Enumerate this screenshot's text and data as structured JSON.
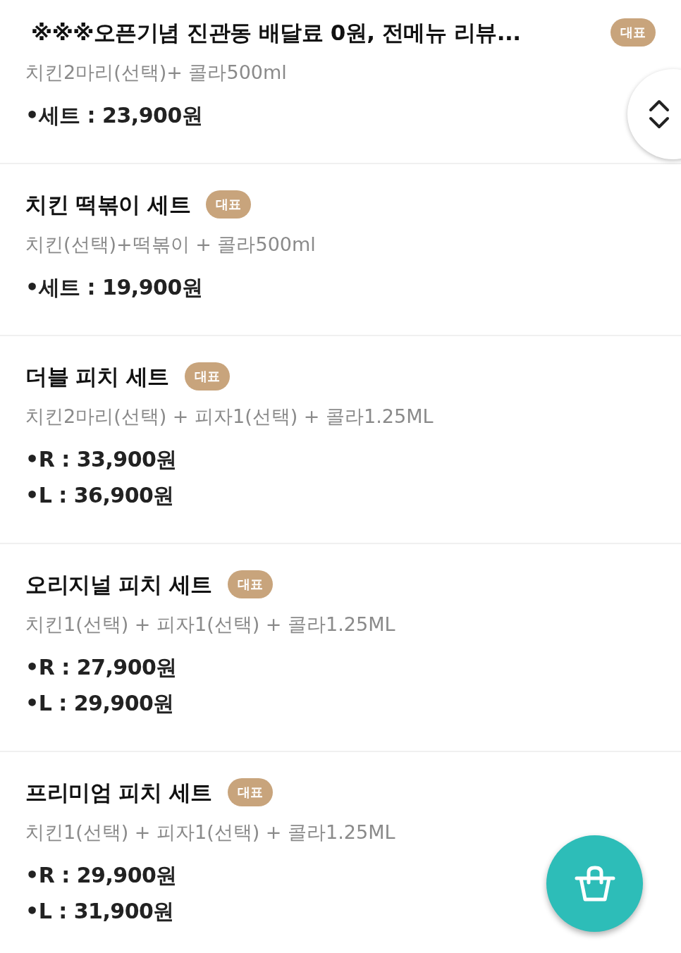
{
  "menu_items": [
    {
      "title": "※※※오픈기념 진관동 배달료 0원, 전메뉴 리뷰...",
      "badge": "대표",
      "description": "치킨2마리(선택)+ 콜라500ml",
      "prices": [
        "•세트 : 23,900원"
      ]
    },
    {
      "title": "치킨 떡볶이 세트",
      "badge": "대표",
      "description": "치킨(선택)+떡볶이 + 콜라500ml",
      "prices": [
        "•세트 : 19,900원"
      ]
    },
    {
      "title": "더블 피치 세트",
      "badge": "대표",
      "description": "치킨2마리(선택) + 피자1(선택) + 콜라1.25ML",
      "prices": [
        "•R : 33,900원",
        "•L : 36,900원"
      ]
    },
    {
      "title": "오리지널 피치 세트",
      "badge": "대표",
      "description": "치킨1(선택) + 피자1(선택) + 콜라1.25ML",
      "prices": [
        "•R : 27,900원",
        "•L : 29,900원"
      ]
    },
    {
      "title": "프리미엄 피치 세트",
      "badge": "대표",
      "description": "치킨1(선택) + 피자1(선택) + 콜라1.25ML",
      "prices": [
        "•R : 29,900원",
        "•L : 31,900원"
      ]
    }
  ]
}
